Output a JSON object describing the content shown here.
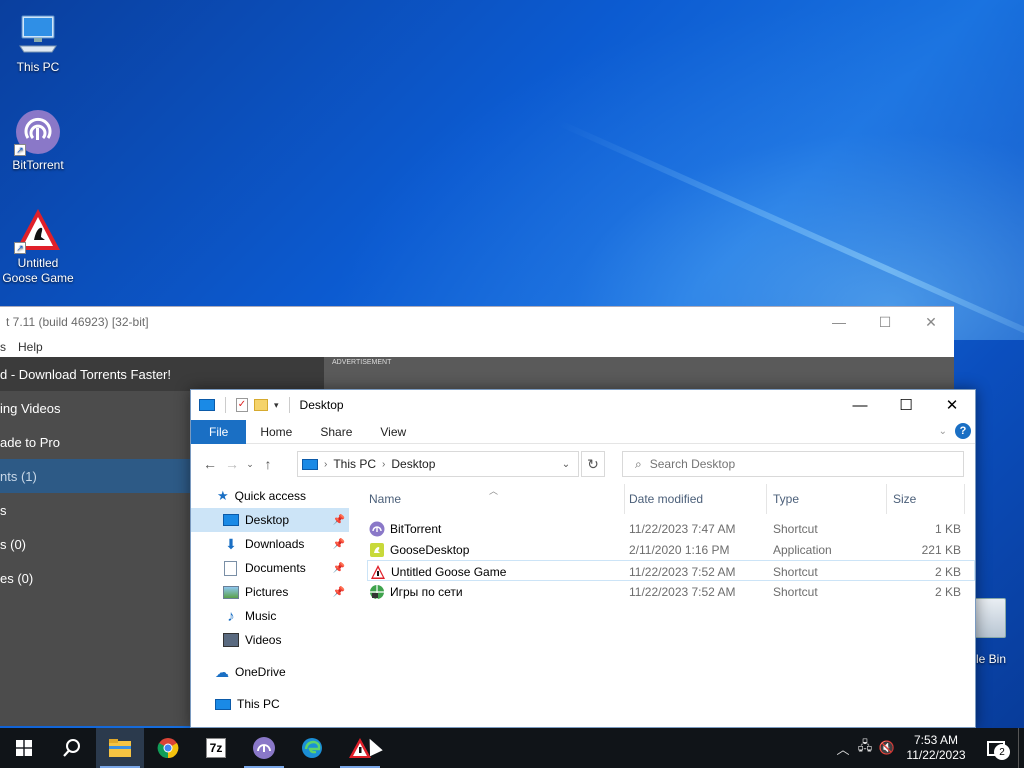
{
  "desktop": {
    "icons": [
      {
        "label": "This PC",
        "icon": "computer-icon"
      },
      {
        "label": "BitTorrent",
        "icon": "bittorrent-icon"
      },
      {
        "label": "Untitled Goose Game",
        "icon": "goose-game-icon"
      }
    ],
    "recycle_bin_label": "le Bin"
  },
  "bittorrent_window": {
    "title": "t 7.11  (build 46923) [32-bit]",
    "menu": [
      "s",
      "Help"
    ],
    "sidebar": [
      "d - Download Torrents Faster!",
      "ing Videos",
      "ade to Pro",
      "nts (1)",
      "s",
      "s (0)",
      "es (0)"
    ],
    "ad_label": "ADVERTISEMENT"
  },
  "explorer": {
    "title": "Desktop",
    "ribbon_tabs": [
      "File",
      "Home",
      "Share",
      "View"
    ],
    "address": {
      "root": "This PC",
      "current": "Desktop"
    },
    "search_placeholder": "Search Desktop",
    "nav_pane": {
      "quick_access": "Quick access",
      "items": [
        {
          "label": "Desktop",
          "icon": "desktop-folder-icon",
          "pinned": true,
          "selected": true
        },
        {
          "label": "Downloads",
          "icon": "download-arrow-icon",
          "pinned": true
        },
        {
          "label": "Documents",
          "icon": "documents-icon",
          "pinned": true
        },
        {
          "label": "Pictures",
          "icon": "pictures-icon",
          "pinned": true
        },
        {
          "label": "Music",
          "icon": "music-note-icon"
        },
        {
          "label": "Videos",
          "icon": "videos-icon"
        }
      ],
      "onedrive": "OneDrive",
      "this_pc": "This PC"
    },
    "columns": {
      "name": "Name",
      "date": "Date modified",
      "type": "Type",
      "size": "Size"
    },
    "files": [
      {
        "name": "BitTorrent",
        "date": "11/22/2023 7:47 AM",
        "type": "Shortcut",
        "size": "1 KB",
        "icon": "bittorrent-icon"
      },
      {
        "name": "GooseDesktop",
        "date": "2/11/2020 1:16 PM",
        "type": "Application",
        "size": "221 KB",
        "icon": "goose-desktop-icon"
      },
      {
        "name": "Untitled Goose Game",
        "date": "11/22/2023 7:52 AM",
        "type": "Shortcut",
        "size": "2 KB",
        "icon": "goose-game-icon"
      },
      {
        "name": "Игры по сети",
        "date": "11/22/2023 7:52 AM",
        "type": "Shortcut",
        "size": "2 KB",
        "icon": "network-games-icon"
      }
    ]
  },
  "taskbar": {
    "apps": [
      "file-explorer-icon",
      "chrome-icon",
      "7zip-icon",
      "bittorrent-icon",
      "edge-icon",
      "goose-game-icon"
    ],
    "seven_zip_label": "7z",
    "time": "7:53 AM",
    "date": "11/22/2023",
    "notification_count": "2"
  }
}
